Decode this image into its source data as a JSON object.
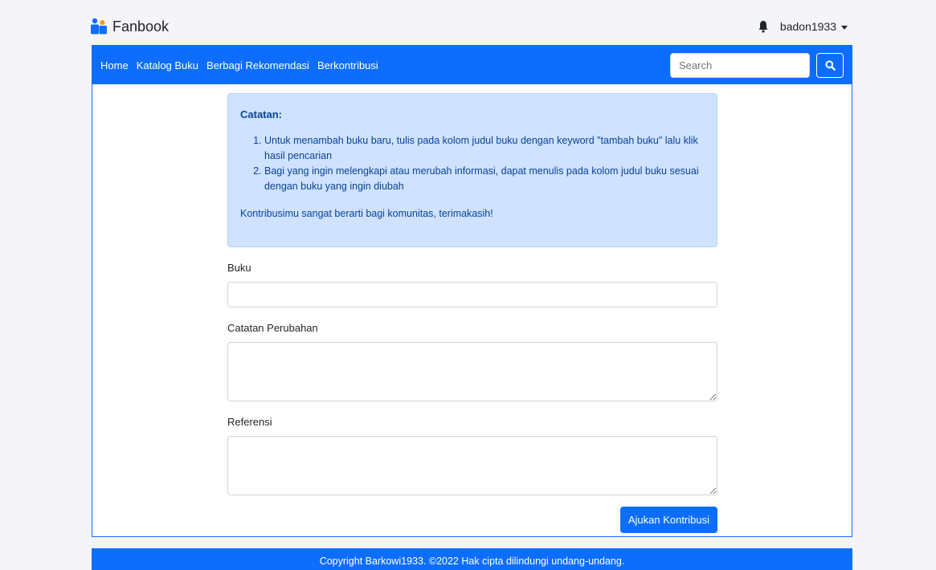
{
  "header": {
    "brand": "Fanbook",
    "username": "badon1933"
  },
  "nav": {
    "links": [
      "Home",
      "Katalog Buku",
      "Berbagi Rekomendasi",
      "Berkontribusi"
    ],
    "search_placeholder": "Search"
  },
  "notice": {
    "title": "Catatan:",
    "items": [
      "Untuk menambah buku baru, tulis pada kolom judul buku dengan keyword \"tambah buku\" lalu klik hasil pencarian",
      "Bagi yang ingin melengkapi atau merubah informasi, dapat menulis pada kolom judul buku sesuai dengan buku yang ingin diubah"
    ],
    "footer": "Kontribusimu sangat berarti bagi komunitas, terimakasih!"
  },
  "form": {
    "book_label": "Buku",
    "book_value": "",
    "changes_label": "Catatan Perubahan",
    "changes_value": "",
    "reference_label": "Referensi",
    "reference_value": "",
    "submit_label": "Ajukan Kontribusi"
  },
  "footer": {
    "text": "Copyright Barkowi1933. ©2022 Hak cipta dilindungi undang-undang."
  },
  "colors": {
    "primary": "#0d6efd",
    "alert_bg": "#cfe2ff",
    "alert_text": "#084298"
  },
  "icons": {
    "brand": "people-icon",
    "notifications": "bell-icon",
    "search": "search-icon",
    "user_menu": "caret-down-icon"
  }
}
